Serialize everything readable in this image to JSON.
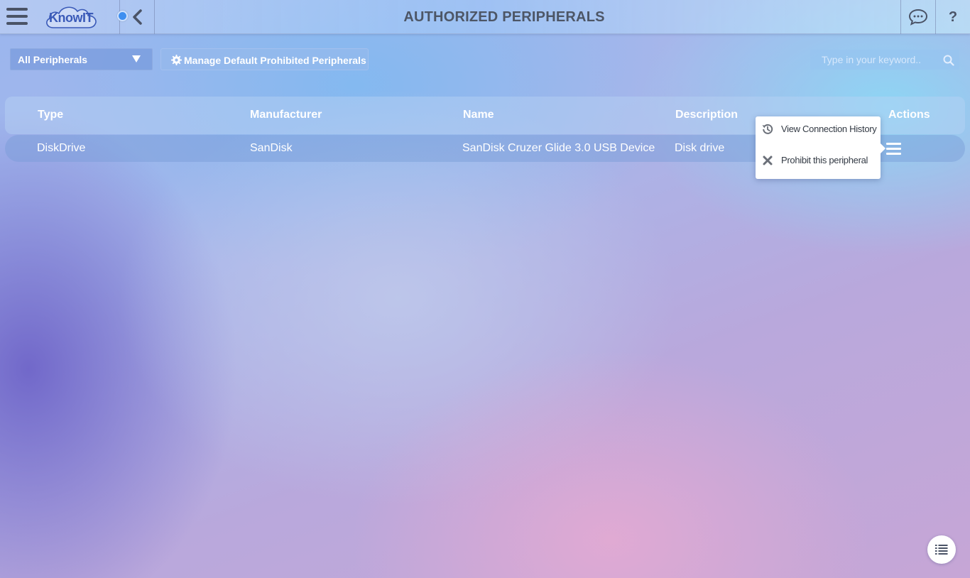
{
  "header": {
    "logo_text": "KnowIT",
    "title": "AUTHORIZED PERIPHERALS",
    "help_label": "?"
  },
  "toolbar": {
    "filter_selected": "All Peripherals",
    "manage_button_label": "Manage Default Prohibited Peripherals",
    "search_placeholder": "Type in your keyword..",
    "search_value": ""
  },
  "table": {
    "columns": [
      "Type",
      "Manufacturer",
      "Name",
      "Description",
      "Actions"
    ],
    "rows": [
      {
        "type": "DiskDrive",
        "manufacturer": "SanDisk",
        "name": "SanDisk Cruzer Glide 3.0 USB Device",
        "description": "Disk drive"
      }
    ]
  },
  "action_menu": {
    "items": [
      {
        "label": "View Connection History",
        "icon": "history-icon"
      },
      {
        "label": "Prohibit this peripheral",
        "icon": "close-icon"
      }
    ]
  },
  "colors": {
    "title_text": "#4d5666",
    "status_dot": "#3f8ff0",
    "logo_text": "#3a5ab8"
  }
}
